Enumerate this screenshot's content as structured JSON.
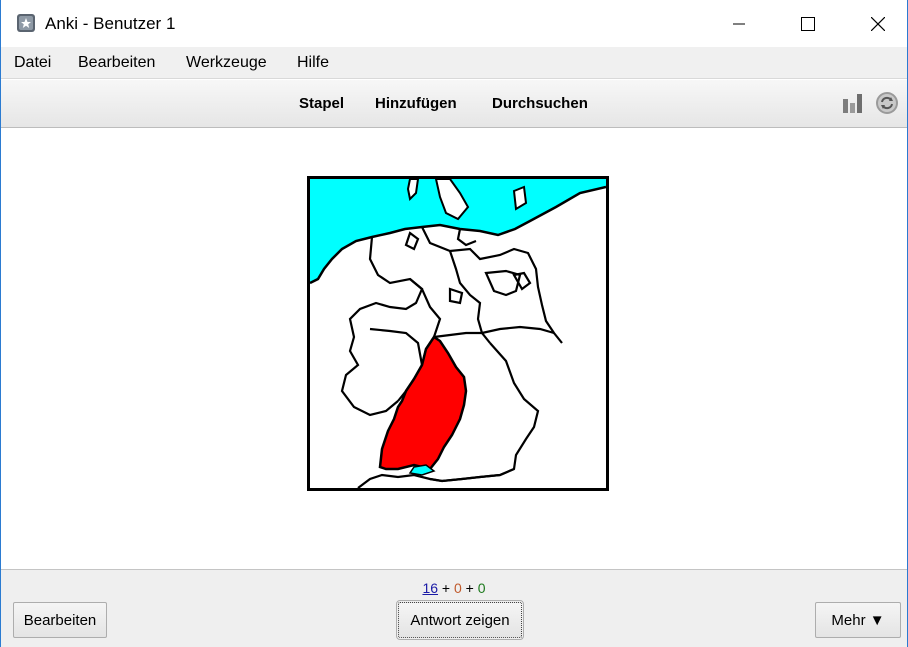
{
  "window": {
    "title": "Anki - Benutzer 1",
    "accent_color": "#2b7bd1"
  },
  "menu": {
    "items": [
      "Datei",
      "Bearbeiten",
      "Werkzeuge",
      "Hilfe"
    ]
  },
  "toolbar": {
    "links": [
      "Stapel",
      "Hinzufügen",
      "Durchsuchen"
    ],
    "icons": [
      "stats-icon",
      "sync-icon"
    ]
  },
  "card": {
    "image": "map-of-germany-states",
    "highlighted_region_color": "#ff0000",
    "water_color": "#00ffff"
  },
  "counts": {
    "new": "16",
    "learning": "0",
    "review": "0",
    "separator": "+"
  },
  "buttons": {
    "edit": "Bearbeiten",
    "show_answer": "Antwort zeigen",
    "more": "Mehr ▼"
  }
}
